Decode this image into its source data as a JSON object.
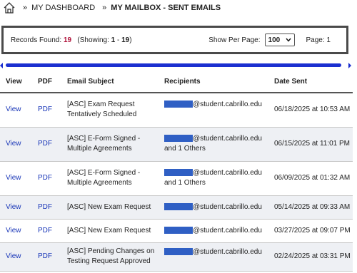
{
  "breadcrumbs": {
    "home_icon": "home-icon",
    "dashboard": "MY DASHBOARD",
    "current": "MY MAILBOX - SENT EMAILS",
    "separator": "»"
  },
  "summary": {
    "records_label": "Records Found:",
    "records_count": "19",
    "showing_prefix": "(Showing:",
    "showing_start": "1",
    "showing_dash": "-",
    "showing_end": "19",
    "showing_suffix": ")",
    "per_page_label": "Show Per Page:",
    "per_page_value": "100",
    "page_label": "Page: 1"
  },
  "table": {
    "headers": {
      "view": "View",
      "pdf": "PDF",
      "subject": "Email Subject",
      "recipients": "Recipients",
      "date": "Date Sent"
    },
    "rows": [
      {
        "view": "View",
        "pdf": "PDF",
        "subject1": "[ASC] Exam Request",
        "subject2": "Tentatively Scheduled",
        "recipient": "@student.cabrillo.edu",
        "others": "",
        "date": "06/18/2025 at 10:53 AM"
      },
      {
        "view": "View",
        "pdf": "PDF",
        "subject1": "[ASC] E-Form Signed -",
        "subject2": "Multiple Agreements",
        "recipient": "@student.cabrillo.edu",
        "others": "and 1 Others",
        "date": "06/15/2025 at 11:01 PM"
      },
      {
        "view": "View",
        "pdf": "PDF",
        "subject1": "[ASC] E-Form Signed -",
        "subject2": "Multiple Agreements",
        "recipient": "@student.cabrillo.edu",
        "others": "and 1 Others",
        "date": "06/09/2025 at 01:32 AM"
      },
      {
        "view": "View",
        "pdf": "PDF",
        "subject1": "[ASC] New Exam Request",
        "subject2": "",
        "recipient": "@student.cabrillo.edu",
        "others": "",
        "date": "05/14/2025 at 09:33 AM"
      },
      {
        "view": "View",
        "pdf": "PDF",
        "subject1": "[ASC] New Exam Request",
        "subject2": "",
        "recipient": "@student.cabrillo.edu",
        "others": "",
        "date": "03/27/2025 at 09:07 PM"
      },
      {
        "view": "View",
        "pdf": "PDF",
        "subject1": "[ASC] Pending Changes on",
        "subject2": "Testing Request Approved",
        "recipient": "@student.cabrillo.edu",
        "others": "",
        "date": "02/24/2025 at 03:31 PM"
      }
    ]
  },
  "colors": {
    "accent": "#1b2fd0",
    "count": "#b0123a",
    "link": "#1a37b8",
    "redaction": "#2f5fc4"
  }
}
